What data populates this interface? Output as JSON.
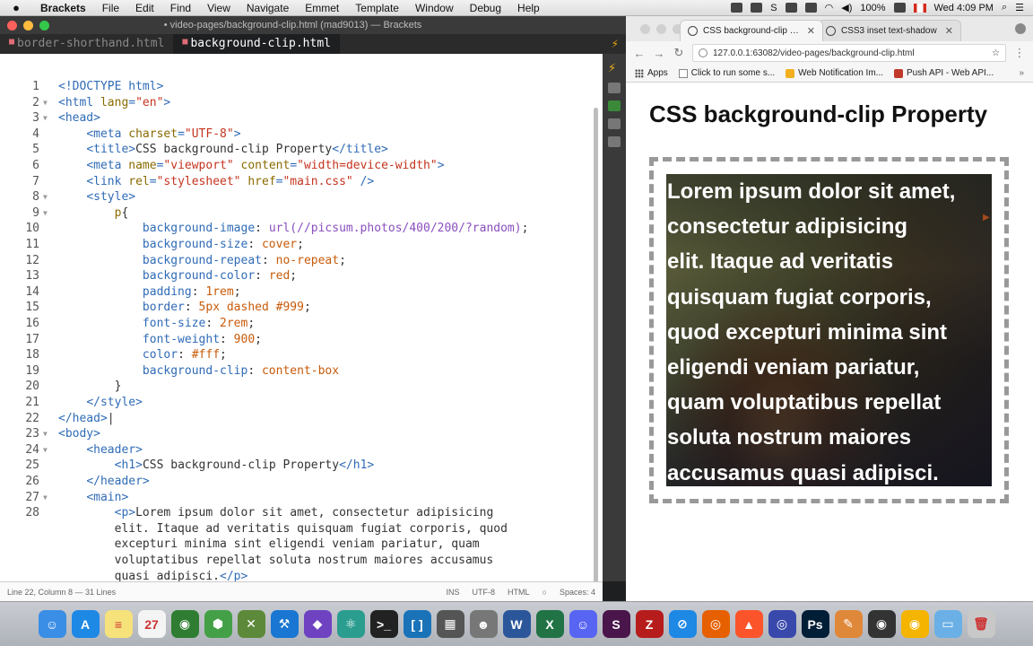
{
  "menubar": {
    "app_name": "Brackets",
    "items": [
      "File",
      "Edit",
      "Find",
      "View",
      "Navigate",
      "Emmet",
      "Template",
      "Window",
      "Debug",
      "Help"
    ],
    "battery": "100%",
    "clock": "Wed 4:09 PM"
  },
  "editor": {
    "window_title": "• video-pages/background-clip.html (mad9013) — Brackets",
    "tabs": [
      {
        "label": "border-shorthand.html",
        "active": false
      },
      {
        "label": "background-clip.html",
        "active": true
      }
    ],
    "lines": [
      {
        "n": "1",
        "fold": "",
        "segs": [
          [
            "tag",
            "<!DOCTYPE html>"
          ]
        ]
      },
      {
        "n": "2",
        "fold": "▼",
        "segs": [
          [
            "tag",
            "<html "
          ],
          [
            "attr",
            "lang"
          ],
          [
            "tag",
            "="
          ],
          [
            "str",
            "\"en\""
          ],
          [
            "tag",
            ">"
          ]
        ]
      },
      {
        "n": "3",
        "fold": "▼",
        "segs": [
          [
            "tag",
            "<head>"
          ]
        ]
      },
      {
        "n": "4",
        "fold": "",
        "segs": [
          [
            "plain",
            "    "
          ],
          [
            "tag",
            "<meta "
          ],
          [
            "attr",
            "charset"
          ],
          [
            "tag",
            "="
          ],
          [
            "str",
            "\"UTF-8\""
          ],
          [
            "tag",
            ">"
          ]
        ]
      },
      {
        "n": "5",
        "fold": "",
        "segs": [
          [
            "plain",
            "    "
          ],
          [
            "tag",
            "<title>"
          ],
          [
            "plain",
            "CSS background-clip Property"
          ],
          [
            "tag",
            "</title>"
          ]
        ]
      },
      {
        "n": "6",
        "fold": "",
        "segs": [
          [
            "plain",
            "    "
          ],
          [
            "tag",
            "<meta "
          ],
          [
            "attr",
            "name"
          ],
          [
            "tag",
            "="
          ],
          [
            "str",
            "\"viewport\""
          ],
          [
            "plain",
            " "
          ],
          [
            "attr",
            "content"
          ],
          [
            "tag",
            "="
          ],
          [
            "str",
            "\"width=device-width\""
          ],
          [
            "tag",
            ">"
          ]
        ]
      },
      {
        "n": "7",
        "fold": "",
        "segs": [
          [
            "plain",
            "    "
          ],
          [
            "tag",
            "<link "
          ],
          [
            "attr",
            "rel"
          ],
          [
            "tag",
            "="
          ],
          [
            "str",
            "\"stylesheet\""
          ],
          [
            "plain",
            " "
          ],
          [
            "attr",
            "href"
          ],
          [
            "tag",
            "="
          ],
          [
            "str",
            "\"main.css\""
          ],
          [
            "plain",
            " "
          ],
          [
            "tag",
            "/>"
          ]
        ]
      },
      {
        "n": "8",
        "fold": "▼",
        "segs": [
          [
            "plain",
            "    "
          ],
          [
            "tag",
            "<style>"
          ]
        ]
      },
      {
        "n": "9",
        "fold": "▼",
        "segs": [
          [
            "plain",
            "        "
          ],
          [
            "attr",
            "p"
          ],
          [
            "plain",
            "{"
          ]
        ]
      },
      {
        "n": "10",
        "fold": "",
        "segs": [
          [
            "plain",
            "            "
          ],
          [
            "prop",
            "background-image"
          ],
          [
            "plain",
            ": "
          ],
          [
            "val",
            "url(//picsum.photos/400/200/?random)"
          ],
          [
            "plain",
            ";"
          ]
        ]
      },
      {
        "n": "11",
        "fold": "",
        "segs": [
          [
            "plain",
            "            "
          ],
          [
            "prop",
            "background-size"
          ],
          [
            "plain",
            ": "
          ],
          [
            "num",
            "cover"
          ],
          [
            "plain",
            ";"
          ]
        ]
      },
      {
        "n": "12",
        "fold": "",
        "segs": [
          [
            "plain",
            "            "
          ],
          [
            "prop",
            "background-repeat"
          ],
          [
            "plain",
            ": "
          ],
          [
            "num",
            "no-repeat"
          ],
          [
            "plain",
            ";"
          ]
        ]
      },
      {
        "n": "13",
        "fold": "",
        "segs": [
          [
            "plain",
            "            "
          ],
          [
            "prop",
            "background-color"
          ],
          [
            "plain",
            ": "
          ],
          [
            "num",
            "red"
          ],
          [
            "plain",
            ";"
          ]
        ]
      },
      {
        "n": "14",
        "fold": "",
        "segs": [
          [
            "plain",
            "            "
          ],
          [
            "prop",
            "padding"
          ],
          [
            "plain",
            ": "
          ],
          [
            "num",
            "1rem"
          ],
          [
            "plain",
            ";"
          ]
        ]
      },
      {
        "n": "15",
        "fold": "",
        "segs": [
          [
            "plain",
            "            "
          ],
          [
            "prop",
            "border"
          ],
          [
            "plain",
            ": "
          ],
          [
            "num",
            "5px dashed #999"
          ],
          [
            "plain",
            ";"
          ]
        ]
      },
      {
        "n": "16",
        "fold": "",
        "segs": [
          [
            "plain",
            "            "
          ],
          [
            "prop",
            "font-size"
          ],
          [
            "plain",
            ": "
          ],
          [
            "num",
            "2rem"
          ],
          [
            "plain",
            ";"
          ]
        ]
      },
      {
        "n": "17",
        "fold": "",
        "segs": [
          [
            "plain",
            "            "
          ],
          [
            "prop",
            "font-weight"
          ],
          [
            "plain",
            ": "
          ],
          [
            "num",
            "900"
          ],
          [
            "plain",
            ";"
          ]
        ]
      },
      {
        "n": "18",
        "fold": "",
        "segs": [
          [
            "plain",
            "            "
          ],
          [
            "prop",
            "color"
          ],
          [
            "plain",
            ": "
          ],
          [
            "num",
            "#fff"
          ],
          [
            "plain",
            ";"
          ]
        ]
      },
      {
        "n": "19",
        "fold": "",
        "segs": [
          [
            "plain",
            "            "
          ],
          [
            "prop",
            "background-clip"
          ],
          [
            "plain",
            ": "
          ],
          [
            "num",
            "content-box"
          ]
        ]
      },
      {
        "n": "20",
        "fold": "",
        "segs": [
          [
            "plain",
            "        }"
          ]
        ]
      },
      {
        "n": "21",
        "fold": "",
        "segs": [
          [
            "plain",
            "    "
          ],
          [
            "tag",
            "</style>"
          ]
        ]
      },
      {
        "n": "22",
        "fold": "",
        "segs": [
          [
            "tag",
            "</head>"
          ],
          [
            "plain",
            "|"
          ]
        ]
      },
      {
        "n": "23",
        "fold": "▼",
        "segs": [
          [
            "tag",
            "<body>"
          ]
        ]
      },
      {
        "n": "24",
        "fold": "▼",
        "segs": [
          [
            "plain",
            "    "
          ],
          [
            "tag",
            "<header>"
          ]
        ]
      },
      {
        "n": "25",
        "fold": "",
        "segs": [
          [
            "plain",
            "        "
          ],
          [
            "tag",
            "<h1>"
          ],
          [
            "plain",
            "CSS background-clip Property"
          ],
          [
            "tag",
            "</h1>"
          ]
        ]
      },
      {
        "n": "26",
        "fold": "",
        "segs": [
          [
            "plain",
            "    "
          ],
          [
            "tag",
            "</header>"
          ]
        ]
      },
      {
        "n": "27",
        "fold": "▼",
        "segs": [
          [
            "plain",
            "    "
          ],
          [
            "tag",
            "<main>"
          ]
        ]
      },
      {
        "n": "28",
        "fold": "",
        "segs": [
          [
            "plain",
            "        "
          ],
          [
            "tag",
            "<p>"
          ],
          [
            "plain",
            "Lorem ipsum dolor sit amet, consectetur adipisicing"
          ]
        ]
      },
      {
        "n": "",
        "fold": "",
        "segs": [
          [
            "plain",
            "        elit. Itaque ad veritatis quisquam fugiat corporis, quod"
          ]
        ]
      },
      {
        "n": "",
        "fold": "",
        "segs": [
          [
            "plain",
            "        excepturi minima sint eligendi veniam pariatur, quam"
          ]
        ]
      },
      {
        "n": "",
        "fold": "",
        "segs": [
          [
            "plain",
            "        voluptatibus repellat soluta nostrum maiores accusamus"
          ]
        ]
      },
      {
        "n": "",
        "fold": "",
        "segs": [
          [
            "plain",
            "        quasi adipisci."
          ],
          [
            "tag",
            "</p>"
          ]
        ]
      },
      {
        "n": "29",
        "fold": "",
        "segs": [
          [
            "plain",
            "    "
          ],
          [
            "tag",
            "</main>"
          ]
        ]
      }
    ],
    "status": {
      "cursor": "Line 22, Column 8 — 31 Lines",
      "mode": "INS",
      "encoding": "UTF-8",
      "language": "HTML",
      "spaces": "Spaces: 4"
    }
  },
  "browser": {
    "tabs": [
      {
        "label": "CSS background-clip Prop",
        "active": true
      },
      {
        "label": "CSS3 inset text-shadow",
        "active": false
      }
    ],
    "url": "127.0.0.1:63082/video-pages/background-clip.html",
    "bookmarks": [
      "Apps",
      "Click to run some s...",
      "Web Notification Im...",
      "Push API - Web API..."
    ],
    "page": {
      "h1": "CSS background-clip Property",
      "paragraph_lines": [
        "Lorem ipsum dolor sit amet,",
        "consectetur adipisicing",
        "elit. Itaque ad veritatis",
        "quisquam fugiat corporis,",
        "quod excepturi minima sint",
        "eligendi veniam pariatur,",
        "quam voluptatibus repellat",
        "soluta nostrum maiores",
        "accusamus quasi adipisci."
      ]
    }
  },
  "dock": {
    "icons": [
      {
        "name": "finder",
        "color": "#3a8ee6",
        "glyph": "☺"
      },
      {
        "name": "app-store",
        "color": "#1e88e5",
        "glyph": "A"
      },
      {
        "name": "notes",
        "color": "#f6e27a",
        "glyph": "≡"
      },
      {
        "name": "calendar",
        "color": "#f4f4f4",
        "glyph": "27"
      },
      {
        "name": "chrome",
        "color": "#2e7d32",
        "glyph": "◉"
      },
      {
        "name": "node",
        "color": "#43a047",
        "glyph": "⬢"
      },
      {
        "name": "tools",
        "color": "#5d8a3a",
        "glyph": "✕"
      },
      {
        "name": "xcode",
        "color": "#1976d2",
        "glyph": "⚒"
      },
      {
        "name": "github",
        "color": "#6f42c1",
        "glyph": "◆"
      },
      {
        "name": "atom",
        "color": "#2a9d8f",
        "glyph": "⚛"
      },
      {
        "name": "terminal",
        "color": "#222222",
        "glyph": ">_"
      },
      {
        "name": "brackets",
        "color": "#1a73b8",
        "glyph": "[ ]"
      },
      {
        "name": "notebook",
        "color": "#555555",
        "glyph": "▦"
      },
      {
        "name": "gimp",
        "color": "#777777",
        "glyph": "☻"
      },
      {
        "name": "word",
        "color": "#2b579a",
        "glyph": "W"
      },
      {
        "name": "excel",
        "color": "#217346",
        "glyph": "X"
      },
      {
        "name": "discord",
        "color": "#5865f2",
        "glyph": "☺"
      },
      {
        "name": "slack",
        "color": "#4a154b",
        "glyph": "S"
      },
      {
        "name": "filezilla",
        "color": "#b71c1c",
        "glyph": "Z"
      },
      {
        "name": "safari",
        "color": "#1e88e5",
        "glyph": "⊘"
      },
      {
        "name": "firefox",
        "color": "#e66000",
        "glyph": "◎"
      },
      {
        "name": "brave",
        "color": "#fb542b",
        "glyph": "▲"
      },
      {
        "name": "firefox-dev",
        "color": "#3949ab",
        "glyph": "◎"
      },
      {
        "name": "photoshop",
        "color": "#001e36",
        "glyph": "Ps"
      },
      {
        "name": "pencil",
        "color": "#e0883a",
        "glyph": "✎"
      },
      {
        "name": "obs",
        "color": "#333333",
        "glyph": "◉"
      },
      {
        "name": "chrome-canary",
        "color": "#f4b400",
        "glyph": "◉"
      },
      {
        "name": "folder",
        "color": "#6ab0e6",
        "glyph": "▭"
      },
      {
        "name": "trash",
        "color": "#c8c8c8",
        "glyph": "🗑"
      }
    ]
  }
}
